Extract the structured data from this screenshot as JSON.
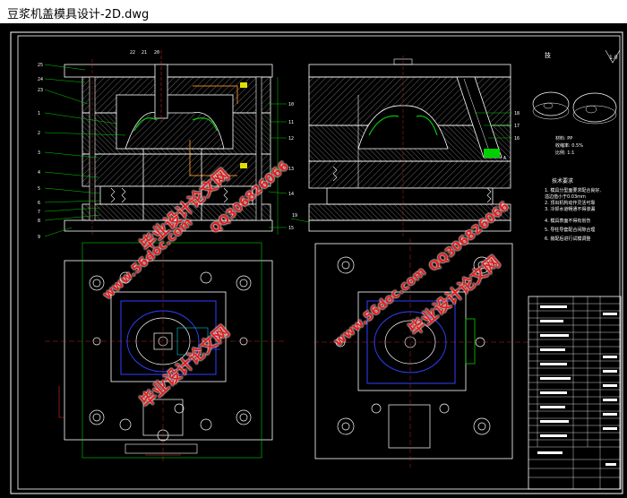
{
  "window": {
    "title": "豆浆机盖模具设计-2D.dwg"
  },
  "watermarks": {
    "url": "www.56doc.com",
    "qq": "QQ306826066",
    "cn": "毕业设计论文网"
  },
  "colors": {
    "background": "#000000",
    "line_white": "#ffffff",
    "line_green": "#00d000",
    "line_blue": "#3040ff",
    "line_red": "#e03030",
    "line_yellow": "#e0e000",
    "line_cyan": "#00c8d0",
    "line_orange": "#e08020",
    "watermark": "#e02020"
  },
  "drawing": {
    "views": [
      "main-section-view",
      "side-section-view",
      "bottom-plan-view-left",
      "bottom-plan-view-right",
      "product-isometric",
      "title-block"
    ]
  }
}
